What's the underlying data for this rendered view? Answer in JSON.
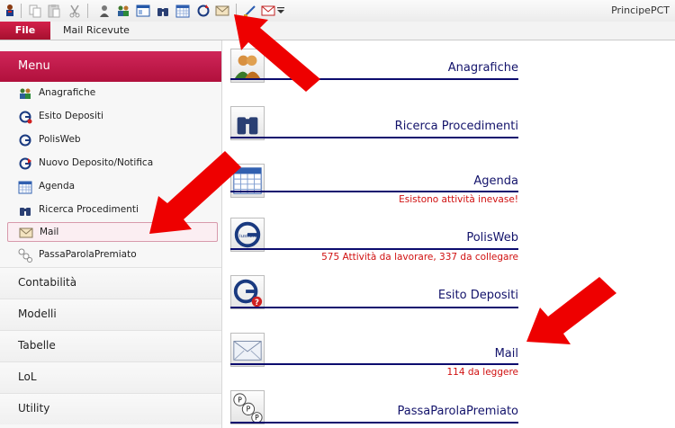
{
  "app": {
    "title": "PrincipePCT"
  },
  "ribbon": {
    "file_label": "File",
    "tabs": [
      {
        "label": "Mail Ricevute"
      }
    ]
  },
  "quick_access": {
    "icons": [
      "app-logo-icon",
      "copy-icon",
      "paste-icon",
      "cut-icon",
      "user-icon",
      "users-icon",
      "window-icon",
      "binoculars-icon",
      "calendar-icon",
      "refresh-icon",
      "mail-icon",
      "brush-icon",
      "envelope-dropdown-icon",
      "customize-icon"
    ]
  },
  "nav": {
    "menu_label": "Menu",
    "items": [
      {
        "label": "Anagrafiche",
        "icon": "users-icon"
      },
      {
        "label": "Esito Depositi",
        "icon": "giustizia-g-icon"
      },
      {
        "label": "PolisWeb",
        "icon": "giustizia-g-icon"
      },
      {
        "label": "Nuovo Deposito/Notifica",
        "icon": "giustizia-g-icon"
      },
      {
        "label": "Agenda",
        "icon": "calendar-icon"
      },
      {
        "label": "Ricerca Procedimenti",
        "icon": "binoculars-icon"
      },
      {
        "label": "Mail",
        "icon": "mail-icon",
        "selected": true
      },
      {
        "label": "PassaParolaPremiato",
        "icon": "ppp-icon"
      }
    ],
    "sections": [
      {
        "label": "Contabilità"
      },
      {
        "label": "Modelli"
      },
      {
        "label": "Tabelle"
      },
      {
        "label": "LoL"
      },
      {
        "label": "Utility"
      }
    ]
  },
  "main": {
    "entries": [
      {
        "title": "Anagrafiche",
        "subtitle": "",
        "icon": "people-icon"
      },
      {
        "title": "Ricerca Procedimenti",
        "subtitle": "",
        "icon": "binoculars-icon"
      },
      {
        "title": "Agenda",
        "subtitle": "Esistono attività inevase!",
        "icon": "calendar-icon"
      },
      {
        "title": "PolisWeb",
        "subtitle": "575 Attività da lavorare, 337 da collegare",
        "icon": "giustizia-icon"
      },
      {
        "title": "Esito Depositi",
        "subtitle": "",
        "icon": "giustizia-question-icon"
      },
      {
        "title": "Mail",
        "subtitle": "114 da leggere",
        "icon": "envelope-icon"
      },
      {
        "title": "PassaParolaPremiato",
        "subtitle": "",
        "icon": "ppp-icon"
      }
    ]
  },
  "colors": {
    "accent": "#c4184a",
    "title_text": "#13136b",
    "rule": "#0c0c6e",
    "alert": "#d01010",
    "arrow": "#ee0000"
  }
}
